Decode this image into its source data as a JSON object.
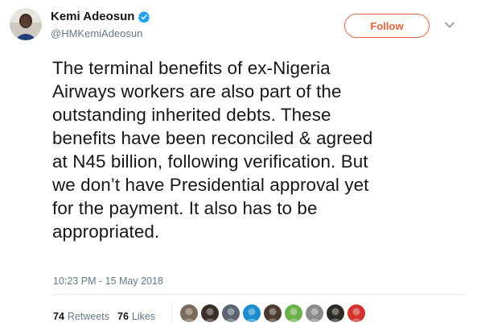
{
  "user": {
    "display_name": "Kemi Adeosun",
    "handle": "@HMKemiAdeosun",
    "verified": true
  },
  "follow_label": "Follow",
  "tweet": {
    "lines": [
      "The terminal benefits of ex-Nigeria",
      "Airways workers are also part of the",
      "outstanding inherited debts. These",
      "benefits have been reconciled & agreed",
      "at N45 billion, following verification. But",
      "we don’t have Presidential approval yet",
      "for the payment. It also has to be",
      "appropriated."
    ],
    "timestamp": "10:23 PM - 15 May 2018"
  },
  "stats": {
    "retweets_count": "74",
    "retweets_label": "Retweets",
    "likes_count": "76",
    "likes_label": "Likes"
  },
  "likers": [
    {
      "color": "#7a6a5a"
    },
    {
      "color": "#3a2e2a"
    },
    {
      "color": "#5a6470"
    },
    {
      "color": "#1a8ccf"
    },
    {
      "color": "#4a3a30"
    },
    {
      "color": "#6ab04c"
    },
    {
      "color": "#8a8a8a"
    },
    {
      "color": "#2e2a26"
    },
    {
      "color": "#d0342c"
    }
  ],
  "colors": {
    "accent": "#e8633a",
    "verified": "#1da1f2",
    "muted": "#657786"
  }
}
